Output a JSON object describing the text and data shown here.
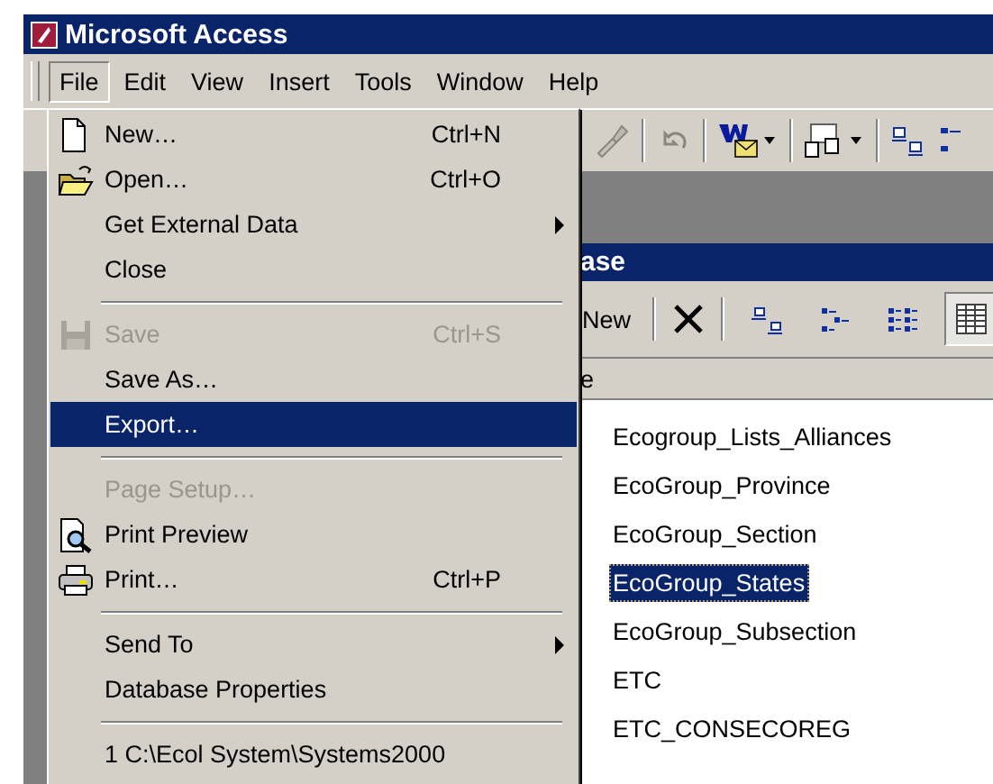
{
  "window": {
    "title": "Microsoft Access"
  },
  "menu_bar": [
    {
      "label": "File",
      "selected": true
    },
    {
      "label": "Edit",
      "selected": false
    },
    {
      "label": "View",
      "selected": false
    },
    {
      "label": "Insert",
      "selected": false
    },
    {
      "label": "Tools",
      "selected": false
    },
    {
      "label": "Window",
      "selected": false
    },
    {
      "label": "Help",
      "selected": false
    }
  ],
  "file_menu": [
    {
      "kind": "item",
      "label": "New…",
      "shortcut": "Ctrl+N",
      "disabled": false,
      "selected": false,
      "submenu": false
    },
    {
      "kind": "item",
      "label": "Open…",
      "shortcut": "Ctrl+O",
      "disabled": false,
      "selected": false,
      "submenu": false
    },
    {
      "kind": "item",
      "label": "Get External Data",
      "disabled": false,
      "selected": false,
      "submenu": true
    },
    {
      "kind": "item",
      "label": "Close",
      "disabled": false,
      "selected": false,
      "submenu": false
    },
    {
      "kind": "separator"
    },
    {
      "kind": "item",
      "label": "Save",
      "shortcut": "Ctrl+S",
      "disabled": true,
      "selected": false,
      "submenu": false
    },
    {
      "kind": "item",
      "label": "Save As…",
      "disabled": false,
      "selected": false,
      "submenu": false
    },
    {
      "kind": "item",
      "label": "Export…",
      "disabled": false,
      "selected": true,
      "submenu": false
    },
    {
      "kind": "separator"
    },
    {
      "kind": "item",
      "label": "Page Setup…",
      "disabled": true,
      "selected": false,
      "submenu": false
    },
    {
      "kind": "item",
      "label": "Print Preview",
      "disabled": false,
      "selected": false,
      "submenu": false
    },
    {
      "kind": "item",
      "label": "Print…",
      "shortcut": "Ctrl+P",
      "disabled": false,
      "selected": false,
      "submenu": false
    },
    {
      "kind": "separator"
    },
    {
      "kind": "item",
      "label": "Send To",
      "disabled": false,
      "selected": false,
      "submenu": true
    },
    {
      "kind": "item",
      "label": "Database Properties",
      "disabled": false,
      "selected": false,
      "submenu": false
    },
    {
      "kind": "separator"
    },
    {
      "kind": "item",
      "label": "1 C:\\Ecol System\\Systems2000",
      "disabled": false,
      "selected": false,
      "submenu": false
    }
  ],
  "database_window": {
    "title": "ase",
    "new_button": "New",
    "view_buttons": [
      {
        "selected": false
      },
      {
        "selected": false
      },
      {
        "selected": false
      },
      {
        "selected": true
      }
    ],
    "column_header": "e",
    "items": [
      {
        "label": "Ecogroup_Lists_Alliances",
        "selected": false
      },
      {
        "label": "EcoGroup_Province",
        "selected": false
      },
      {
        "label": "EcoGroup_Section",
        "selected": false
      },
      {
        "label": "EcoGroup_States",
        "selected": true
      },
      {
        "label": "EcoGroup_Subsection",
        "selected": false
      },
      {
        "label": "ETC",
        "selected": false
      },
      {
        "label": "ETC_CONSECOREG",
        "selected": false
      }
    ]
  }
}
